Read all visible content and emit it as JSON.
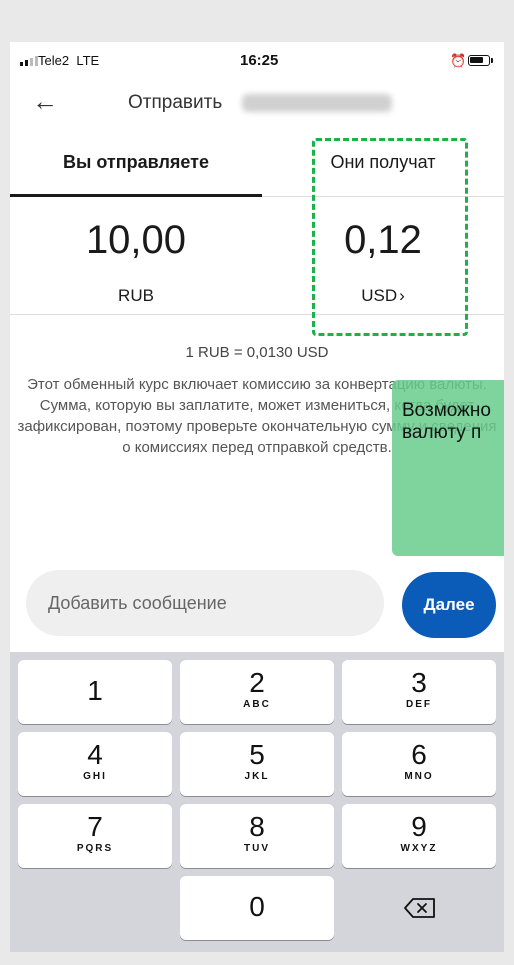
{
  "status_bar": {
    "carrier": "Tele2",
    "network": "LTE",
    "time": "16:25"
  },
  "header": {
    "title": "Отправить"
  },
  "tabs": {
    "send": "Вы отправляете",
    "receive": "Они получат"
  },
  "amounts": {
    "send_value": "10,00",
    "send_currency": "RUB",
    "receive_value": "0,12",
    "receive_currency": "USD",
    "receive_chevron": "›"
  },
  "exchange": {
    "rate": "1 RUB = 0,0130 USD",
    "disclaimer": "Этот обменный курс включает комиссию за конвертацию валюты. Сумма, которую вы заплатите, может измениться, когда будет зафиксирован, поэтому проверьте окончательную сумму и сведения о комиссиях перед отправкой средств."
  },
  "note": {
    "text": "Возможно\nвалюту п"
  },
  "message": {
    "placeholder": "Добавить сообщение"
  },
  "next": {
    "label": "Далее"
  },
  "keypad": [
    {
      "digit": "1",
      "letters": ""
    },
    {
      "digit": "2",
      "letters": "ABC"
    },
    {
      "digit": "3",
      "letters": "DEF"
    },
    {
      "digit": "4",
      "letters": "GHI"
    },
    {
      "digit": "5",
      "letters": "JKL"
    },
    {
      "digit": "6",
      "letters": "MNO"
    },
    {
      "digit": "7",
      "letters": "PQRS"
    },
    {
      "digit": "8",
      "letters": "TUV"
    },
    {
      "digit": "9",
      "letters": "WXYZ"
    },
    {
      "digit": "0",
      "letters": ""
    }
  ],
  "icons": {
    "back": "arrow-left-icon",
    "delete": "backspace-icon",
    "alarm": "alarm-icon",
    "battery": "battery-icon"
  },
  "colors": {
    "accent": "#0a5cb8",
    "highlight_border": "#1db14a",
    "note_bg": "#69cd8c"
  }
}
